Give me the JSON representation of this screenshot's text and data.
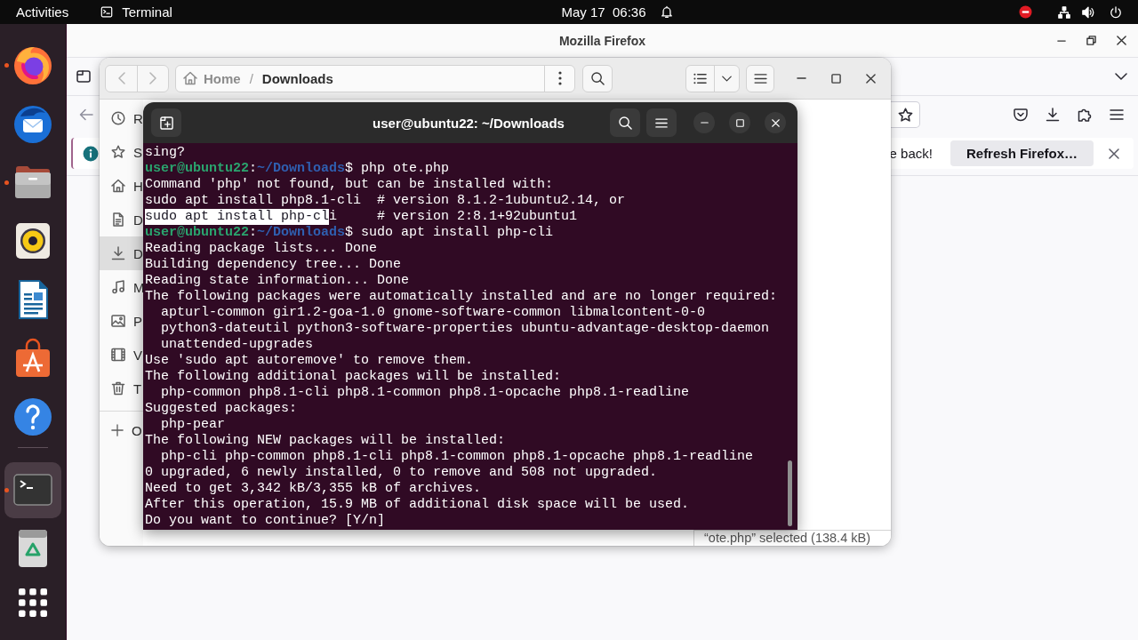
{
  "top_bar": {
    "activities": "Activities",
    "app_menu": "Terminal",
    "clock": "May 17  06:36"
  },
  "dock": {
    "pinned": [
      {
        "kind": "firefox",
        "running": true,
        "selected": false
      },
      {
        "kind": "thunderbird",
        "running": false,
        "selected": false
      },
      {
        "kind": "files",
        "running": true,
        "selected": false
      },
      {
        "kind": "rhythmbox",
        "running": false,
        "selected": false
      },
      {
        "kind": "writer",
        "running": false,
        "selected": false
      },
      {
        "kind": "app-center",
        "running": false,
        "selected": false
      },
      {
        "kind": "help",
        "running": false,
        "selected": false
      }
    ],
    "others": [
      {
        "kind": "terminal",
        "running": true,
        "selected": true
      },
      {
        "kind": "trash",
        "running": false,
        "selected": false
      }
    ]
  },
  "firefox": {
    "title": "Mozilla Firefox",
    "notification": {
      "message": "e back!",
      "button": "Refresh Firefox…"
    }
  },
  "files": {
    "nav": [
      {
        "kind": "back",
        "disabled": true
      },
      {
        "kind": "forward",
        "disabled": true
      }
    ],
    "path": [
      {
        "kind": "home",
        "label": "Home",
        "selected": false
      },
      {
        "kind": "folder",
        "label": "Downloads",
        "selected": true
      }
    ],
    "path_separator": "/",
    "sidebar": [
      {
        "kind": "recent",
        "label": "R",
        "selected": false
      },
      {
        "kind": "starred",
        "label": "S",
        "selected": false
      },
      {
        "kind": "home",
        "label": "H",
        "selected": false
      },
      {
        "kind": "documents",
        "label": "D",
        "selected": false
      },
      {
        "kind": "downloads",
        "label": "D",
        "selected": true
      },
      {
        "kind": "music",
        "label": "M",
        "selected": false
      },
      {
        "kind": "pictures",
        "label": "P",
        "selected": false
      },
      {
        "kind": "videos",
        "label": "V",
        "selected": false
      },
      {
        "kind": "trash",
        "label": "T",
        "selected": false
      }
    ],
    "other_locations": {
      "label": "O"
    },
    "status": "“ote.php” selected (138.4 kB)"
  },
  "terminal": {
    "title": "user@ubuntu22: ~/Downloads",
    "lines": [
      {
        "kind": "output",
        "text": "sing?"
      },
      {
        "kind": "prompt",
        "user": "user@ubuntu22",
        "colon": ":",
        "path": "~/Downloads",
        "command": "$ php ote.php"
      },
      {
        "kind": "output",
        "text": "Command 'php' not found, but can be installed with:"
      },
      {
        "kind": "output",
        "text": "sudo apt install php8.1-cli  # version 8.1.2-1ubuntu2.14, or"
      },
      {
        "kind": "segments",
        "segments": [
          {
            "text": "sudo apt install php-cl",
            "selected": true
          },
          {
            "text": "i     # version 2:8.1+92ubuntu1",
            "selected": false
          }
        ]
      },
      {
        "kind": "prompt",
        "user": "user@ubuntu22",
        "colon": ":",
        "path": "~/Downloads",
        "command": "$ sudo apt install php-cli"
      },
      {
        "kind": "output",
        "text": "Reading package lists... Done"
      },
      {
        "kind": "output",
        "text": "Building dependency tree... Done"
      },
      {
        "kind": "output",
        "text": "Reading state information... Done"
      },
      {
        "kind": "output",
        "text": "The following packages were automatically installed and are no longer required:"
      },
      {
        "kind": "output",
        "text": "  apturl-common gir1.2-goa-1.0 gnome-software-common libmalcontent-0-0"
      },
      {
        "kind": "output",
        "text": "  python3-dateutil python3-software-properties ubuntu-advantage-desktop-daemon"
      },
      {
        "kind": "output",
        "text": "  unattended-upgrades"
      },
      {
        "kind": "output",
        "text": "Use 'sudo apt autoremove' to remove them."
      },
      {
        "kind": "output",
        "text": "The following additional packages will be installed:"
      },
      {
        "kind": "output",
        "text": "  php-common php8.1-cli php8.1-common php8.1-opcache php8.1-readline"
      },
      {
        "kind": "output",
        "text": "Suggested packages:"
      },
      {
        "kind": "output",
        "text": "  php-pear"
      },
      {
        "kind": "output",
        "text": "The following NEW packages will be installed:"
      },
      {
        "kind": "output",
        "text": "  php-cli php-common php8.1-cli php8.1-common php8.1-opcache php8.1-readline"
      },
      {
        "kind": "output",
        "text": "0 upgraded, 6 newly installed, 0 to remove and 508 not upgraded."
      },
      {
        "kind": "output",
        "text": "Need to get 3,342 kB/3,355 kB of archives."
      },
      {
        "kind": "output",
        "text": "After this operation, 15.9 MB of additional disk space will be used."
      },
      {
        "kind": "output",
        "text": "Do you want to continue? [Y/n]"
      }
    ]
  }
}
